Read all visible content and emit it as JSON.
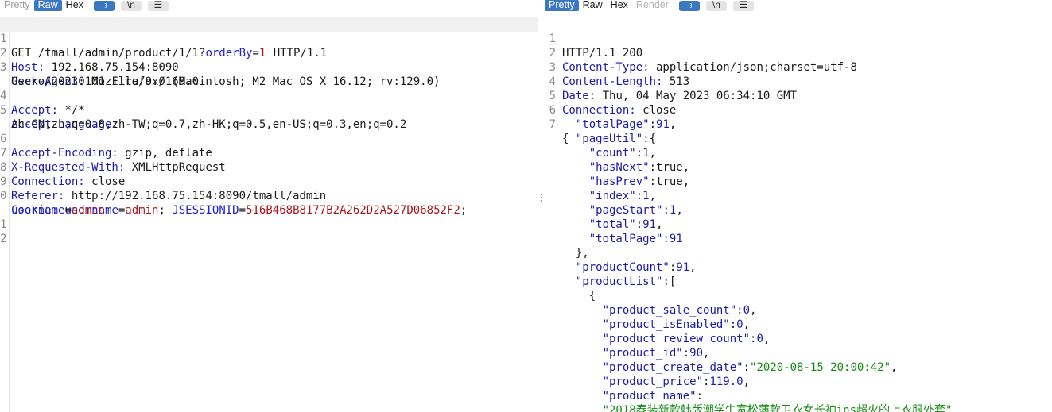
{
  "request": {
    "tabs": {
      "pretty": "Pretty",
      "raw": "Raw",
      "hex": "Hex"
    },
    "buttons": {
      "wrap": "⥽",
      "newline": "\\n",
      "menu": "☰"
    },
    "lines": {
      "l1": {
        "num": "1",
        "method": "GET /tmall/admin/product/1/1?",
        "param_name": "orderBy",
        "eq": "=",
        "param_value": "1",
        "protocol": " HTTP/1.1"
      },
      "l2": {
        "num": "2",
        "key": "Host:",
        "value": " 192.168.75.154:8090"
      },
      "l3": {
        "num": "3",
        "key": "User-Agent:",
        "value": " Mozilla/9.0 (Macintosh; M2 Mac OS X 16.12; rv:129.0)",
        "cont": "Gecko/20230101 Firefox/169.0"
      },
      "l4": {
        "num": "4",
        "key": "Accept:",
        "value": " */*"
      },
      "l5": {
        "num": "5",
        "key": "Accept-Language:",
        "cont": "zh-CN,zh;q=0.8,zh-TW;q=0.7,zh-HK;q=0.5,en-US;q=0.3,en;q=0.2"
      },
      "l6": {
        "num": "6",
        "key": "Accept-Encoding:",
        "value": " gzip, deflate"
      },
      "l7": {
        "num": "7",
        "key": "X-Requested-With:",
        "value": " XMLHttpRequest"
      },
      "l8": {
        "num": "8",
        "key": "Connection:",
        "value": " close"
      },
      "l9": {
        "num": "9",
        "key": "Referer:",
        "value": " http://192.168.75.154:8090/tmall/admin"
      },
      "l10": {
        "num": "0",
        "key": "Cookie:",
        "c1_name": " username",
        "c1_eq": "=",
        "c1_value": "admin",
        "sep1": "; ",
        "c2_name": "JSESSIONID",
        "c2_eq": "=",
        "c2_value": "516B468B8177B2A262D2A527D06852F2",
        "sep2": ";",
        "c3_name": "username",
        "c3_eq": "=",
        "c3_value": "admin"
      },
      "l11": {
        "num": "1"
      },
      "l12": {
        "num": "2"
      }
    }
  },
  "response": {
    "tabs": {
      "pretty": "Pretty",
      "raw": "Raw",
      "hex": "Hex",
      "render": "Render"
    },
    "buttons": {
      "wrap": "⥽",
      "newline": "\\n",
      "menu": "☰"
    },
    "lines": [
      {
        "num": "1",
        "text": "HTTP/1.1 200"
      },
      {
        "num": "2",
        "key": "Content-Type:",
        "value": " application/json;charset=utf-8"
      },
      {
        "num": "3",
        "key": "Content-Length:",
        "value": " 513"
      },
      {
        "num": "4",
        "key": "Date:",
        "value": " Thu, 04 May 2023 06:34:10 GMT"
      },
      {
        "num": "5",
        "key": "Connection:",
        "value": " close"
      },
      {
        "num": "6",
        "text": ""
      },
      {
        "num": "7",
        "text": "{"
      }
    ],
    "json": {
      "totalPage_key": "\"totalPage\"",
      "totalPage_val": "91",
      "pageUtil_key": "\"pageUtil\"",
      "count_key": "\"count\"",
      "count_val": "1",
      "hasNext_key": "\"hasNext\"",
      "hasNext_val": "true",
      "hasPrev_key": "\"hasPrev\"",
      "hasPrev_val": "true",
      "index_key": "\"index\"",
      "index_val": "1",
      "pageStart_key": "\"pageStart\"",
      "pageStart_val": "1",
      "total_key": "\"total\"",
      "total_val": "91",
      "totalPage2_key": "\"totalPage\"",
      "totalPage2_val": "91",
      "productCount_key": "\"productCount\"",
      "productCount_val": "91",
      "productList_key": "\"productList\"",
      "sale_count_key": "\"product_sale_count\"",
      "sale_count_val": "0",
      "isEnabled_key": "\"product_isEnabled\"",
      "isEnabled_val": "0",
      "review_count_key": "\"product_review_count\"",
      "review_count_val": "0",
      "id_key": "\"product_id\"",
      "id_val": "90",
      "create_date_key": "\"product_create_date\"",
      "create_date_val": "\"2020-08-15 20:00:42\"",
      "price_key": "\"product_price\"",
      "price_val": "119.0",
      "name_key": "\"product_name\"",
      "name_val": "\"2018春装新款韩版潮学生宽松薄款卫衣女长袖ins超火的上衣服外套\""
    }
  }
}
